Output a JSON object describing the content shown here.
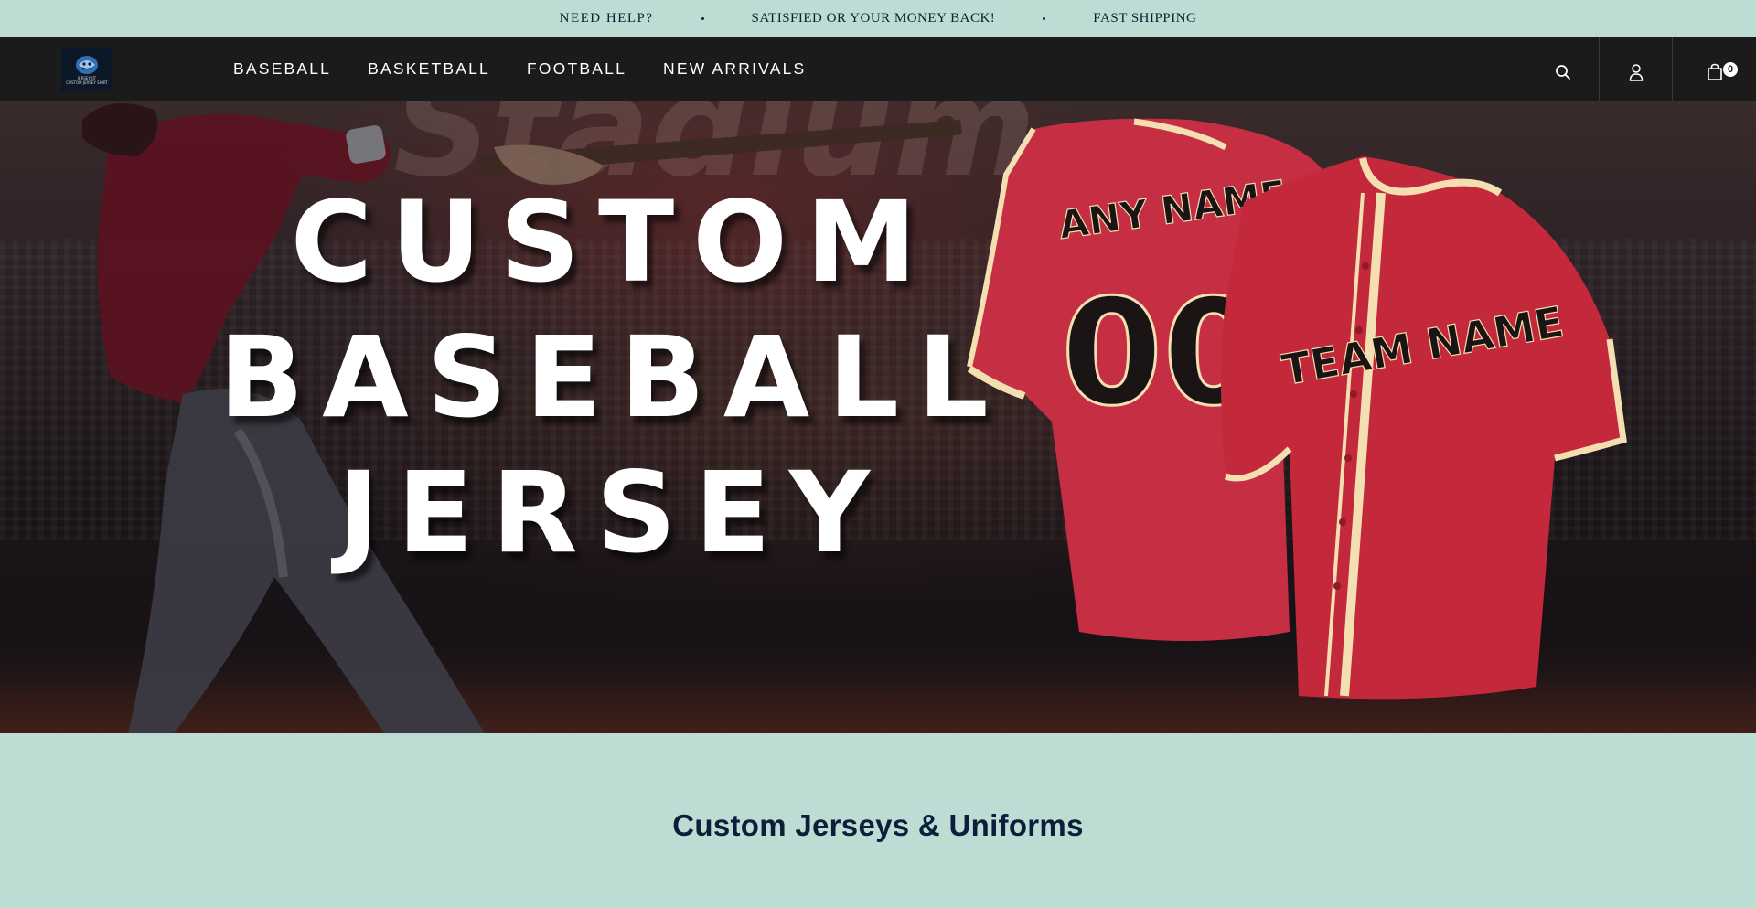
{
  "announcement": {
    "messages": [
      "NEED HELP?",
      "SATISFIED OR YOUR MONEY BACK!",
      "FAST SHIPPING"
    ]
  },
  "header": {
    "logo_text": [
      "JERSEYKIT",
      "CUSTOM JERSEY SHIRT"
    ],
    "nav": [
      "BASEBALL",
      "BASKETBALL",
      "FOOTBALL",
      "NEW ARRIVALS"
    ],
    "icons": [
      "search-icon",
      "account-icon",
      "cart-icon"
    ],
    "cart_count": "0"
  },
  "hero": {
    "title_lines": [
      "CUSTOM",
      "BASEBALL",
      "JERSEY"
    ],
    "jersey_front": {
      "name": "ANY NAME",
      "number": "00"
    },
    "jersey_side": {
      "team": "TEAM NAME"
    }
  },
  "section": {
    "title": "Custom Jerseys & Uniforms"
  },
  "colors": {
    "mint": "#bddcd4",
    "header_bg": "#1b1b1c",
    "jersey_red": "#c62f43",
    "piping": "#f3dfb2",
    "heading_navy": "#0d1e3a"
  }
}
